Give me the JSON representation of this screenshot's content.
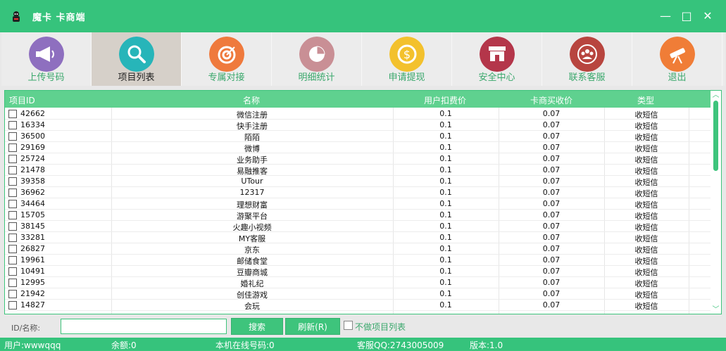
{
  "window": {
    "title": "魔卡 卡商端",
    "minimize": "—",
    "maximize": "□",
    "close": "✕"
  },
  "toolbar": [
    {
      "label": "上传号码",
      "icon": "megaphone-icon",
      "color": "#8e6fbf",
      "active": false
    },
    {
      "label": "项目列表",
      "icon": "magnifier-icon",
      "color": "#27b5b9",
      "active": true
    },
    {
      "label": "专属对接",
      "icon": "target-icon",
      "color": "#ef7a3d",
      "active": false
    },
    {
      "label": "明细统计",
      "icon": "pie-chart-icon",
      "color": "#c98f95",
      "active": false
    },
    {
      "label": "申请提现",
      "icon": "coin-icon",
      "color": "#f3c12d",
      "active": false
    },
    {
      "label": "安全中心",
      "icon": "storefront-icon",
      "color": "#b4364a",
      "active": false
    },
    {
      "label": "联系客服",
      "icon": "people-icon",
      "color": "#b8453f",
      "active": false
    },
    {
      "label": "退出",
      "icon": "telescope-icon",
      "color": "#f07d37",
      "active": false
    }
  ],
  "table": {
    "headers": [
      "项目ID",
      "名称",
      "用户扣费价",
      "卡商买收价",
      "类型"
    ],
    "rows": [
      [
        "42662",
        "微信注册",
        "0.1",
        "0.07",
        "收短信"
      ],
      [
        "16334",
        "快手注册",
        "0.1",
        "0.07",
        "收短信"
      ],
      [
        "36500",
        "陌陌",
        "0.1",
        "0.07",
        "收短信"
      ],
      [
        "29169",
        "微博",
        "0.1",
        "0.07",
        "收短信"
      ],
      [
        "25724",
        "业务助手",
        "0.1",
        "0.07",
        "收短信"
      ],
      [
        "21478",
        "易融推客",
        "0.1",
        "0.07",
        "收短信"
      ],
      [
        "39358",
        "UTour",
        "0.1",
        "0.07",
        "收短信"
      ],
      [
        "36962",
        "12317",
        "0.1",
        "0.07",
        "收短信"
      ],
      [
        "34464",
        "理想财富",
        "0.1",
        "0.07",
        "收短信"
      ],
      [
        "15705",
        "游聚平台",
        "0.1",
        "0.07",
        "收短信"
      ],
      [
        "38145",
        "火趣小视频",
        "0.1",
        "0.07",
        "收短信"
      ],
      [
        "33281",
        "MY客服",
        "0.1",
        "0.07",
        "收短信"
      ],
      [
        "26827",
        "京东",
        "0.1",
        "0.07",
        "收短信"
      ],
      [
        "19961",
        "邮储食堂",
        "0.1",
        "0.07",
        "收短信"
      ],
      [
        "10491",
        "豆瓣商城",
        "0.1",
        "0.07",
        "收短信"
      ],
      [
        "12995",
        "婚礼纪",
        "0.1",
        "0.07",
        "收短信"
      ],
      [
        "21942",
        "创佳游戏",
        "0.1",
        "0.07",
        "收短信"
      ],
      [
        "14827",
        "会玩",
        "0.1",
        "0.07",
        "收短信"
      ]
    ]
  },
  "search": {
    "label": "ID/名称:",
    "value": "",
    "search_button": "搜索",
    "refresh_button": "刷新(R)",
    "checkbox_label": "不做项目列表"
  },
  "status": {
    "user": "用户:wwwqqq",
    "balance": "余额:0",
    "online": "本机在线号码:0",
    "qq": "客服QQ:2743005009",
    "version": "版本:1.0"
  }
}
